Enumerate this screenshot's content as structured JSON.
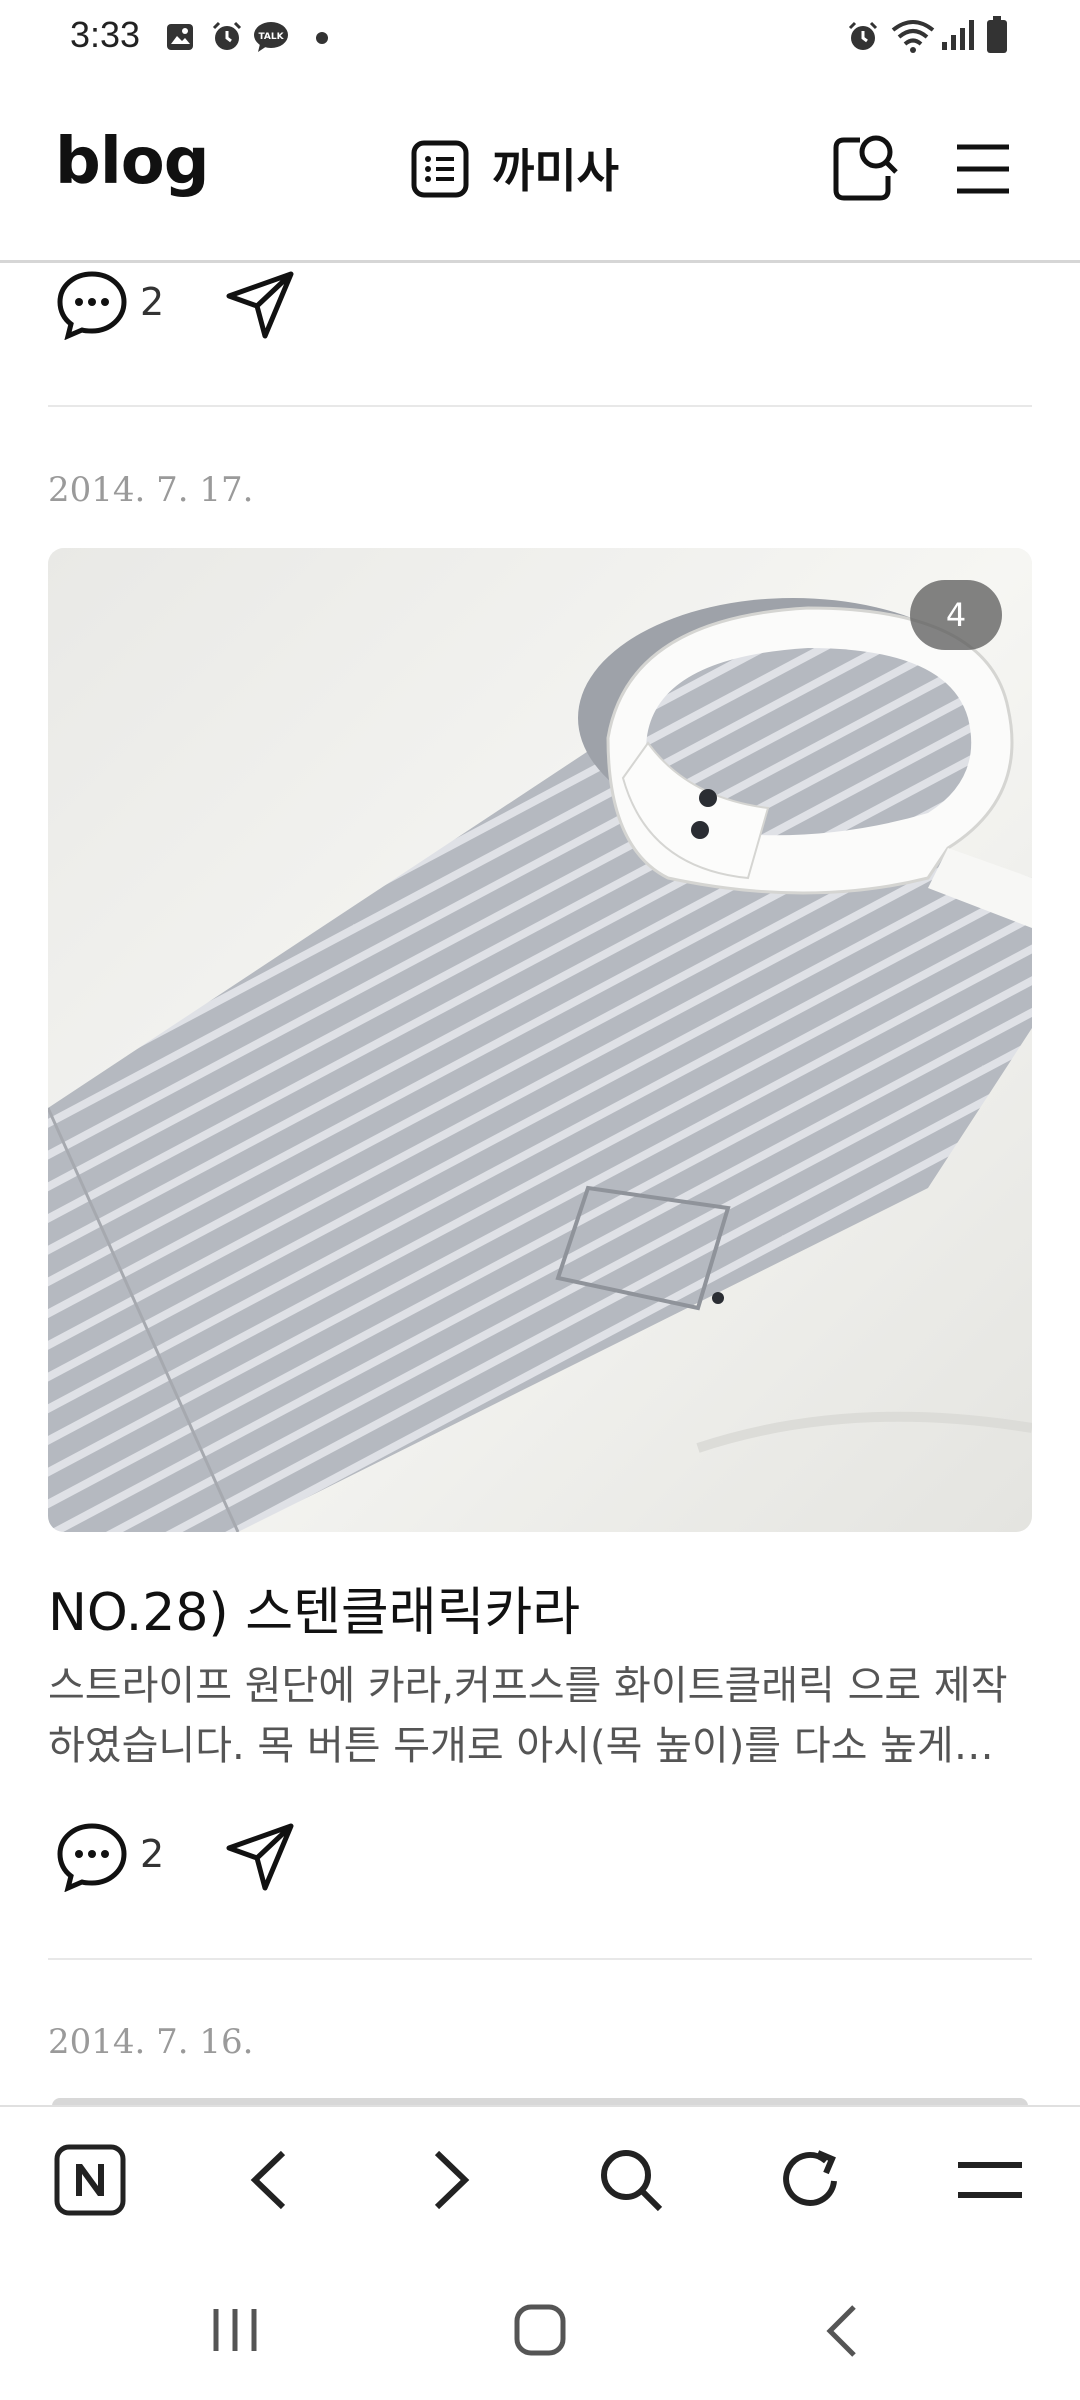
{
  "status_bar": {
    "time": "3:33"
  },
  "header": {
    "logo": "blog",
    "blog_name": "까미사"
  },
  "previous_post": {
    "comment_count": "2"
  },
  "post": {
    "date": "2014. 7. 17.",
    "image_count": "4",
    "title": "NO.28) 스텐클래릭카라",
    "excerpt": "스트라이프 원단에 카라,커프스를 화이트클래릭 으로 제작하였습니다. 목 버튼 두개로 아시(목 높이)를 다소 높게 제...",
    "comment_count": "2"
  },
  "next_post": {
    "date": "2014. 7. 16."
  },
  "colors": {
    "text": "#111111",
    "muted": "#9a9a9a",
    "divider": "#e8e8e8",
    "badge": "#5a5a5a"
  }
}
